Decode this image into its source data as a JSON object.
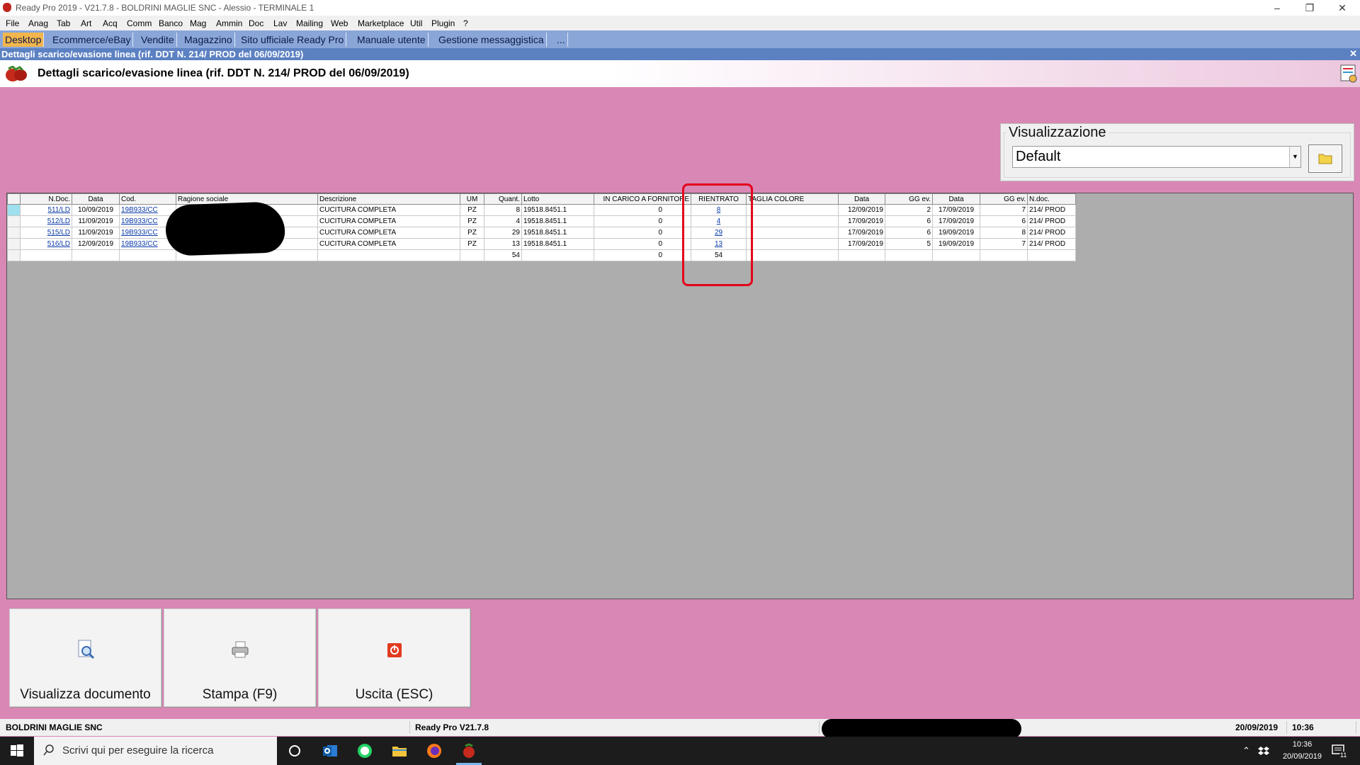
{
  "window": {
    "title": "Ready Pro 2019 - V21.7.8 - BOLDRINI MAGLIE SNC - Alessio - TERMINALE 1",
    "controls": [
      "–",
      "❐",
      "✕"
    ]
  },
  "menu": [
    "File",
    "Anag",
    "Tab",
    "Art",
    "Acq",
    "Comm",
    "Banco",
    "Mag",
    "Ammin",
    "Doc",
    "Lav",
    "Mailing",
    "Web",
    "Marketplace",
    "Util",
    "Plugin",
    "?"
  ],
  "tabs": [
    {
      "label": "Desktop",
      "active": true
    },
    {
      "label": "Ecommerce/eBay",
      "active": false
    },
    {
      "label": "Vendite",
      "active": false
    },
    {
      "label": "Magazzino",
      "active": false
    },
    {
      "label": "Sito ufficiale Ready Pro",
      "active": false
    },
    {
      "label": "Manuale utente",
      "active": false
    },
    {
      "label": "Gestione messaggistica",
      "active": false
    },
    {
      "label": "...",
      "active": false
    }
  ],
  "inner_window": {
    "caption": "Dettagli scarico/evasione linea (rif. DDT N. 214/ PROD del 06/09/2019)",
    "close": "✕"
  },
  "header": {
    "title": "Dettagli scarico/evasione linea (rif. DDT N. 214/ PROD del 06/09/2019)"
  },
  "visualizzazione": {
    "label": "Visualizzazione",
    "selected": "Default"
  },
  "grid": {
    "columns": [
      "",
      "N.Doc.",
      "Data",
      "Cod.",
      "Ragione sociale",
      "Descrizione",
      "UM",
      "Quant.",
      "Lotto",
      "IN CARICO A FORNITORE",
      "RIENTRATO",
      "TAGLIA COLORE",
      "Data",
      "GG ev.",
      "Data",
      "GG ev.",
      "N.doc."
    ],
    "rows": [
      {
        "ndoc": "511/LD",
        "data": "10/09/2019",
        "cod": "19B933/CC",
        "ragione": "",
        "descr": "CUCITURA COMPLETA",
        "um": "PZ",
        "quant": "8",
        "lotto": "19518.8451.1",
        "incarico": "0",
        "rientrato": "8",
        "taglia": "",
        "data2": "12/09/2019",
        "gg1": "2",
        "data3": "17/09/2019",
        "gg2": "7",
        "ndoc2": "214/ PROD"
      },
      {
        "ndoc": "512/LD",
        "data": "11/09/2019",
        "cod": "19B933/CC",
        "ragione": "",
        "descr": "CUCITURA COMPLETA",
        "um": "PZ",
        "quant": "4",
        "lotto": "19518.8451.1",
        "incarico": "0",
        "rientrato": "4",
        "taglia": "",
        "data2": "17/09/2019",
        "gg1": "6",
        "data3": "17/09/2019",
        "gg2": "6",
        "ndoc2": "214/ PROD"
      },
      {
        "ndoc": "515/LD",
        "data": "11/09/2019",
        "cod": "19B933/CC",
        "ragione": "",
        "descr": "CUCITURA COMPLETA",
        "um": "PZ",
        "quant": "29",
        "lotto": "19518.8451.1",
        "incarico": "0",
        "rientrato": "29",
        "taglia": "",
        "data2": "17/09/2019",
        "gg1": "6",
        "data3": "19/09/2019",
        "gg2": "8",
        "ndoc2": "214/ PROD"
      },
      {
        "ndoc": "516/LD",
        "data": "12/09/2019",
        "cod": "19B933/CC",
        "ragione": "",
        "descr": "CUCITURA COMPLETA",
        "um": "PZ",
        "quant": "13",
        "lotto": "19518.8451.1",
        "incarico": "0",
        "rientrato": "13",
        "taglia": "",
        "data2": "17/09/2019",
        "gg1": "5",
        "data3": "19/09/2019",
        "gg2": "7",
        "ndoc2": "214/ PROD"
      }
    ],
    "totals": {
      "quant": "54",
      "incarico": "0",
      "rientrato": "54"
    }
  },
  "buttons": {
    "view": "Visualizza documento",
    "print": "Stampa (F9)",
    "exit": "Uscita (ESC)"
  },
  "status": {
    "company": "BOLDRINI MAGLIE SNC",
    "version": "Ready Pro V21.7.8",
    "date": "20/09/2019",
    "time": "10:36"
  },
  "taskbar": {
    "search_placeholder": "Scrivi qui per eseguire la ricerca",
    "clock_time": "10:36",
    "clock_date": "20/09/2019",
    "notif_count": "11"
  },
  "colors": {
    "background": "#d987b5",
    "tab_bar": "#8aa6d9",
    "active_tab": "#f2b64c",
    "caption": "#5c81c2",
    "highlight": "#e3001b",
    "link": "#0b3aa8"
  }
}
